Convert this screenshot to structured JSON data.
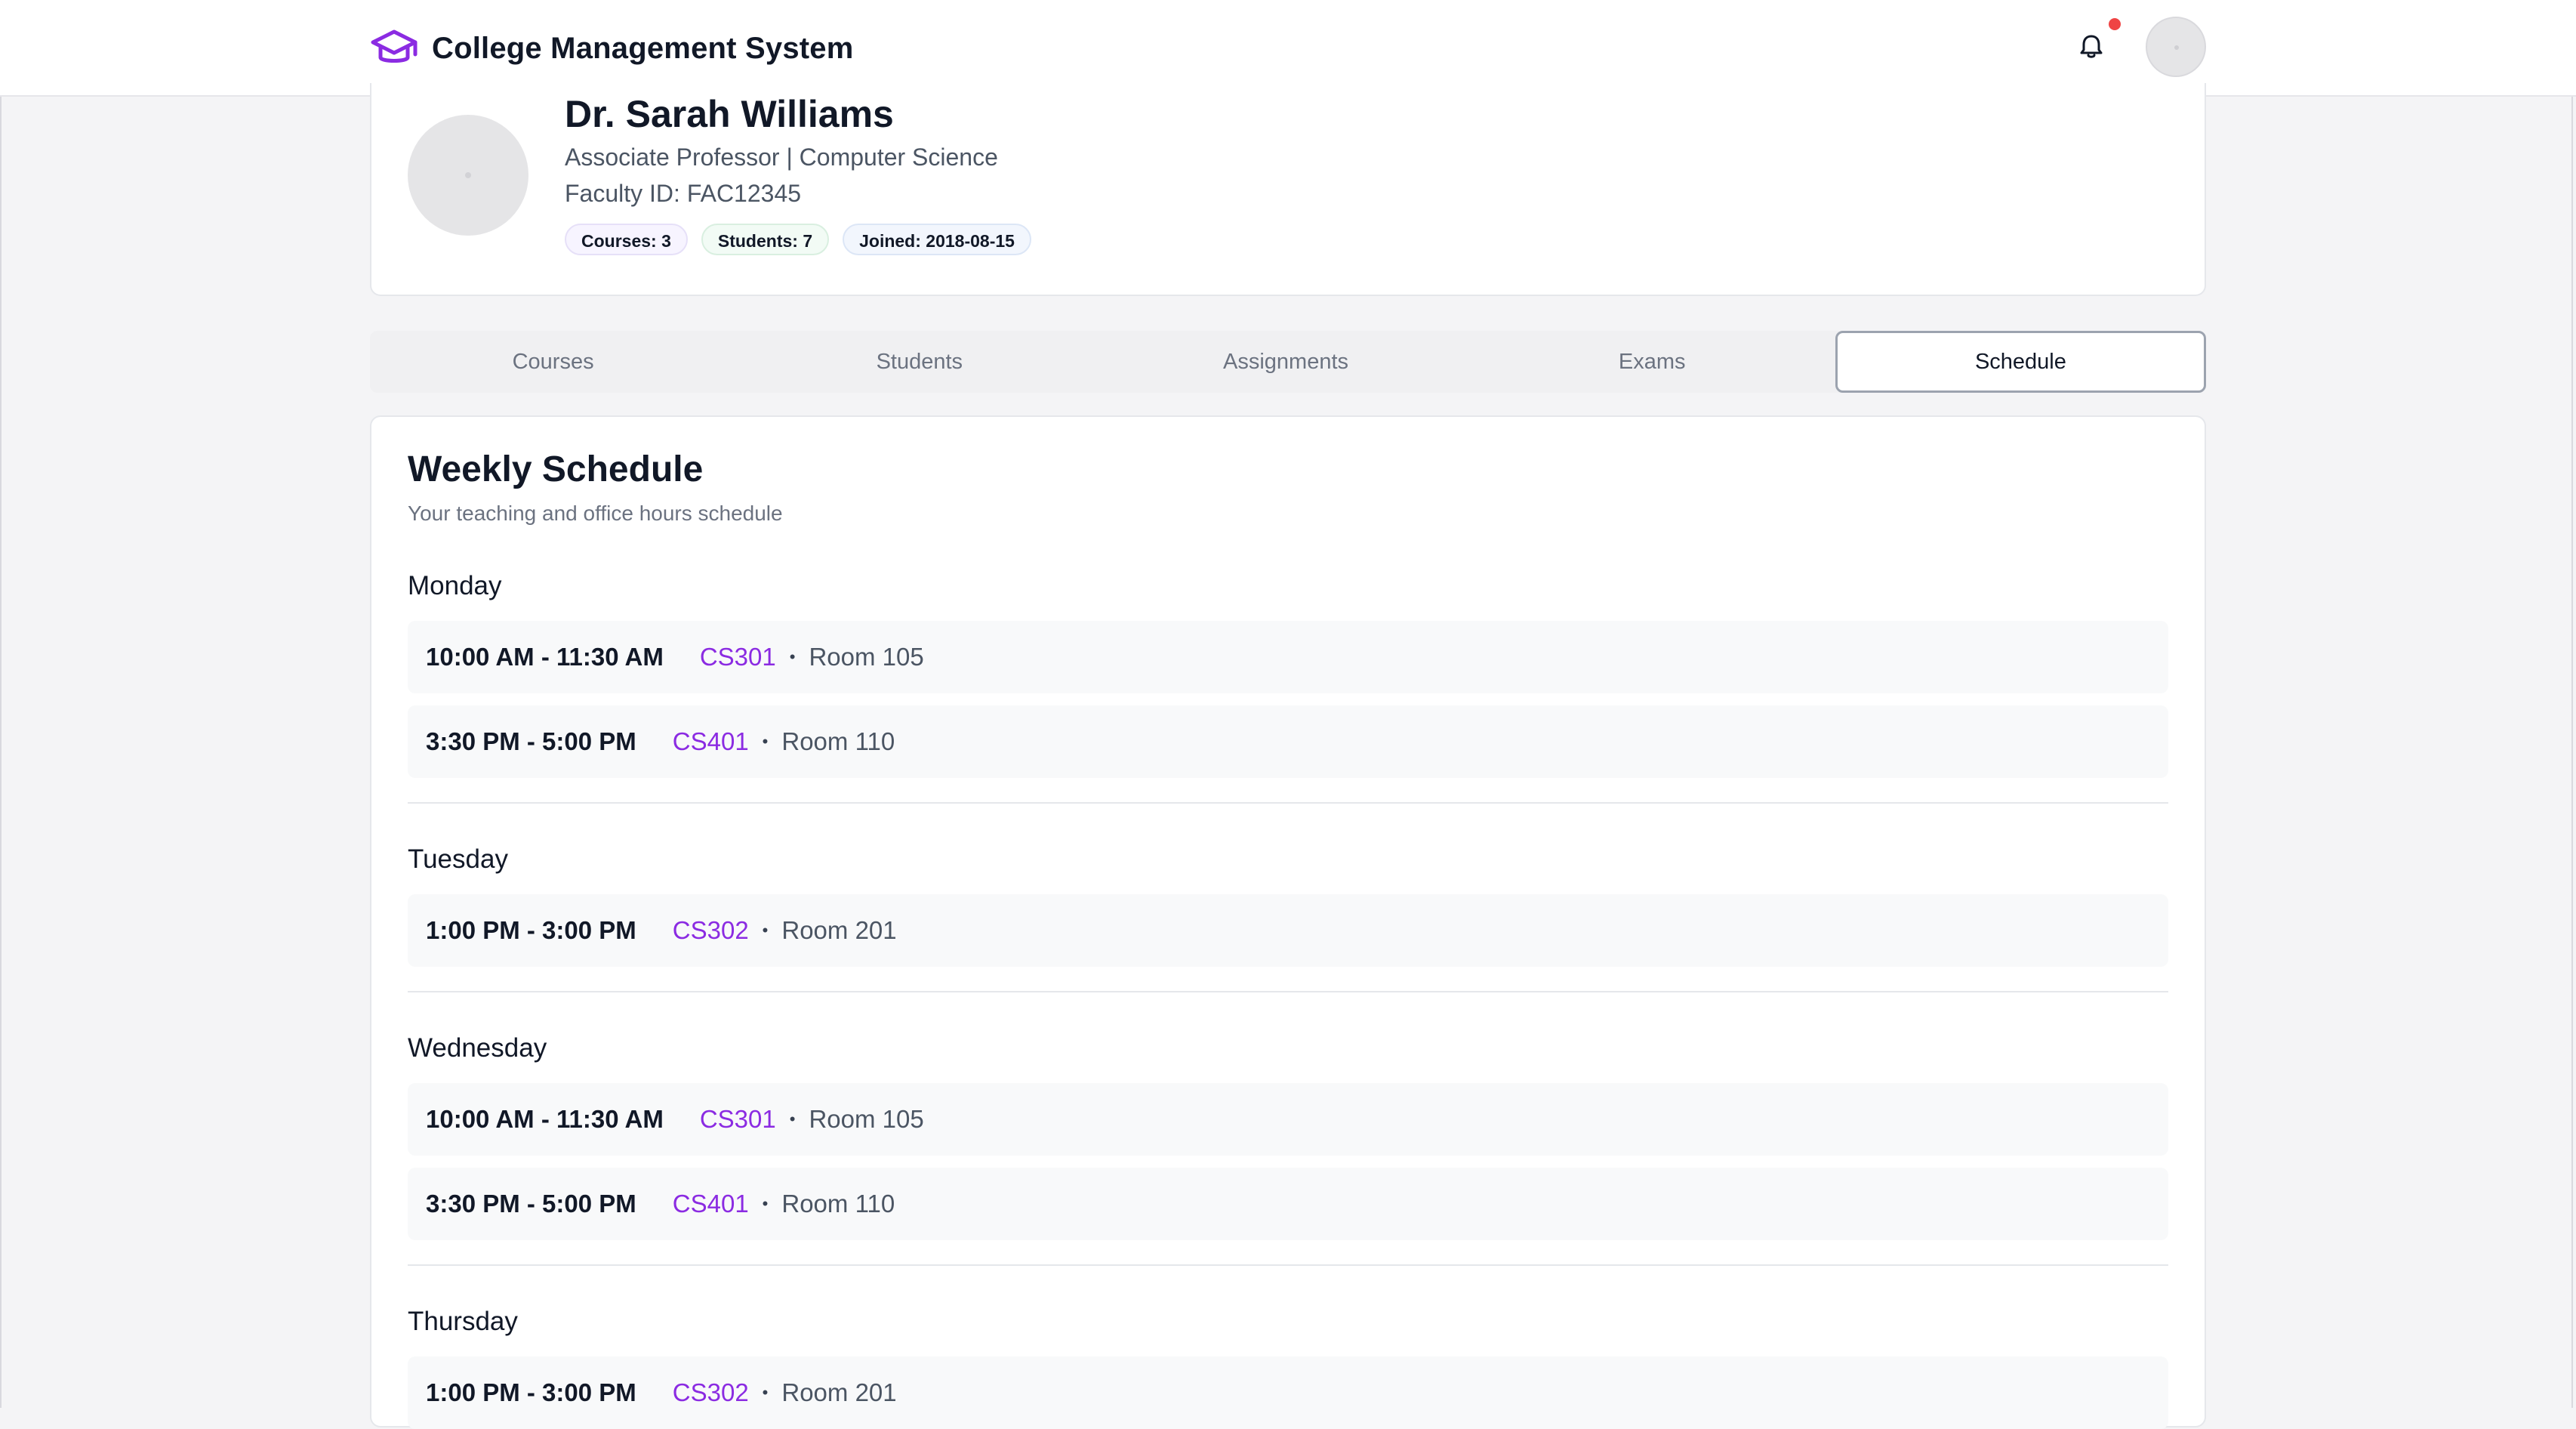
{
  "app": {
    "title": "College Management System",
    "accent": "#8b2be2",
    "notification_dot_color": "#ef4444"
  },
  "profile": {
    "name": "Dr. Sarah Williams",
    "title_line": "Associate Professor | Computer Science",
    "faculty_id": "Faculty ID: FAC12345",
    "chips": {
      "courses": "Courses: 3",
      "students": "Students: 7",
      "joined": "Joined: 2018-08-15"
    }
  },
  "tabs": [
    {
      "label": "Courses",
      "active": false
    },
    {
      "label": "Students",
      "active": false
    },
    {
      "label": "Assignments",
      "active": false
    },
    {
      "label": "Exams",
      "active": false
    },
    {
      "label": "Schedule",
      "active": true
    }
  ],
  "schedule": {
    "title": "Weekly Schedule",
    "subtitle": "Your teaching and office hours schedule",
    "separator": "•",
    "days": [
      {
        "day": "Monday",
        "entries": [
          {
            "time": "10:00 AM - 11:30 AM",
            "course": "CS301",
            "room": "Room 105"
          },
          {
            "time": "3:30 PM - 5:00 PM",
            "course": "CS401",
            "room": "Room 110"
          }
        ]
      },
      {
        "day": "Tuesday",
        "entries": [
          {
            "time": "1:00 PM - 3:00 PM",
            "course": "CS302",
            "room": "Room 201"
          }
        ]
      },
      {
        "day": "Wednesday",
        "entries": [
          {
            "time": "10:00 AM - 11:30 AM",
            "course": "CS301",
            "room": "Room 105"
          },
          {
            "time": "3:30 PM - 5:00 PM",
            "course": "CS401",
            "room": "Room 110"
          }
        ]
      },
      {
        "day": "Thursday",
        "entries": [
          {
            "time": "1:00 PM - 3:00 PM",
            "course": "CS302",
            "room": "Room 201"
          }
        ]
      }
    ]
  }
}
